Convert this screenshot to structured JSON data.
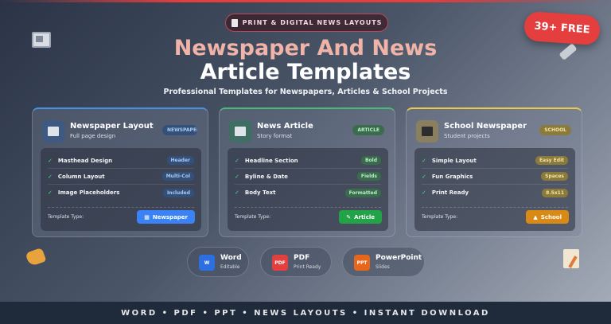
{
  "header": {
    "top_pill": "PRINT & DIGITAL NEWS LAYOUTS",
    "badge": "39+ FREE",
    "title_line1": "Newspaper And News",
    "title_line2": "Article Templates",
    "subtitle": "Professional Templates for Newspapers, Articles & School Projects"
  },
  "cards": [
    {
      "title": "Newspaper Layout",
      "subtitle": "Full page design",
      "tag": "NEWSPAPER",
      "accent": "#4a90e2",
      "features": [
        {
          "label": "Masthead Design",
          "badge": "Header"
        },
        {
          "label": "Column Layout",
          "badge": "Multi-Col"
        },
        {
          "label": "Image Placeholders",
          "badge": "Included"
        }
      ],
      "type_label": "Template Type:",
      "button": "Newspaper",
      "button_color": "#3b82f6"
    },
    {
      "title": "News Article",
      "subtitle": "Story format",
      "tag": "ARTICLE",
      "accent": "#48bb78",
      "features": [
        {
          "label": "Headline Section",
          "badge": "Bold"
        },
        {
          "label": "Byline & Date",
          "badge": "Fields"
        },
        {
          "label": "Body Text",
          "badge": "Formatted"
        }
      ],
      "type_label": "Template Type:",
      "button": "Article",
      "button_color": "#22a347"
    },
    {
      "title": "School Newspaper",
      "subtitle": "Student projects",
      "tag": "SCHOOL",
      "accent": "#ecc94b",
      "features": [
        {
          "label": "Simple Layout",
          "badge": "Easy Edit"
        },
        {
          "label": "Fun Graphics",
          "badge": "Spaces"
        },
        {
          "label": "Print Ready",
          "badge": "8.5x11"
        }
      ],
      "type_label": "Template Type:",
      "button": "School",
      "button_color": "#d98a14"
    }
  ],
  "formats": [
    {
      "icon": "W",
      "name": "Word",
      "desc": "Editable",
      "color": "#2b6fe0"
    },
    {
      "icon": "PDF",
      "name": "PDF",
      "desc": "Print Ready",
      "color": "#e53e3e"
    },
    {
      "icon": "PPT",
      "name": "PowerPoint",
      "desc": "Slides",
      "color": "#e8661c"
    }
  ],
  "footer": "WORD • PDF • PPT   •   NEWS LAYOUTS   •   INSTANT DOWNLOAD"
}
